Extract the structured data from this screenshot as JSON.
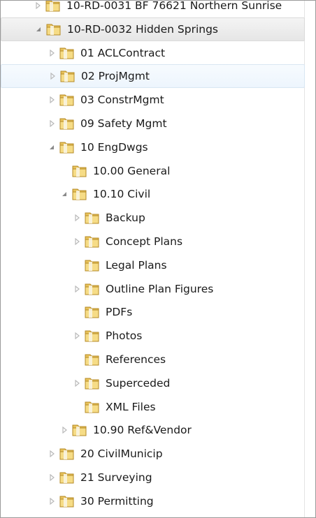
{
  "tree": {
    "items": [
      {
        "label": "10-RD-0031 BF 76621 Northern Sunrise",
        "depth": 1,
        "expander": "closed",
        "state": ""
      },
      {
        "label": "10-RD-0032 Hidden Springs",
        "depth": 1,
        "expander": "open",
        "state": "selected"
      },
      {
        "label": "01 ACLContract",
        "depth": 2,
        "expander": "closed",
        "state": ""
      },
      {
        "label": "02 ProjMgmt",
        "depth": 2,
        "expander": "closed",
        "state": "hover"
      },
      {
        "label": "03 ConstrMgmt",
        "depth": 2,
        "expander": "closed",
        "state": ""
      },
      {
        "label": "09 Safety Mgmt",
        "depth": 2,
        "expander": "closed",
        "state": ""
      },
      {
        "label": "10 EngDwgs",
        "depth": 2,
        "expander": "open",
        "state": ""
      },
      {
        "label": "10.00 General",
        "depth": 3,
        "expander": "none",
        "state": ""
      },
      {
        "label": "10.10 Civil",
        "depth": 3,
        "expander": "open",
        "state": ""
      },
      {
        "label": "Backup",
        "depth": 4,
        "expander": "closed",
        "state": ""
      },
      {
        "label": "Concept Plans",
        "depth": 4,
        "expander": "closed",
        "state": ""
      },
      {
        "label": "Legal Plans",
        "depth": 4,
        "expander": "none",
        "state": ""
      },
      {
        "label": "Outline Plan Figures",
        "depth": 4,
        "expander": "closed",
        "state": ""
      },
      {
        "label": "PDFs",
        "depth": 4,
        "expander": "none",
        "state": ""
      },
      {
        "label": "Photos",
        "depth": 4,
        "expander": "closed",
        "state": ""
      },
      {
        "label": "References",
        "depth": 4,
        "expander": "none",
        "state": ""
      },
      {
        "label": "Superceded",
        "depth": 4,
        "expander": "closed",
        "state": ""
      },
      {
        "label": "XML Files",
        "depth": 4,
        "expander": "none",
        "state": ""
      },
      {
        "label": "10.90 Ref&Vendor",
        "depth": 3,
        "expander": "closed",
        "state": ""
      },
      {
        "label": "20 CivilMunicip",
        "depth": 2,
        "expander": "closed",
        "state": ""
      },
      {
        "label": "21 Surveying",
        "depth": 2,
        "expander": "closed",
        "state": ""
      },
      {
        "label": "30 Permitting",
        "depth": 2,
        "expander": "closed",
        "state": ""
      }
    ]
  },
  "colors": {
    "folder_body": "#e8c25a",
    "folder_front": "#f6dc86",
    "folder_edge": "#b48a26",
    "expander_closed": "#b9b9b9",
    "expander_open": "#8a8a8a",
    "hover_bg": "#edf5fd",
    "selected_bg": "#e6e6e6"
  }
}
